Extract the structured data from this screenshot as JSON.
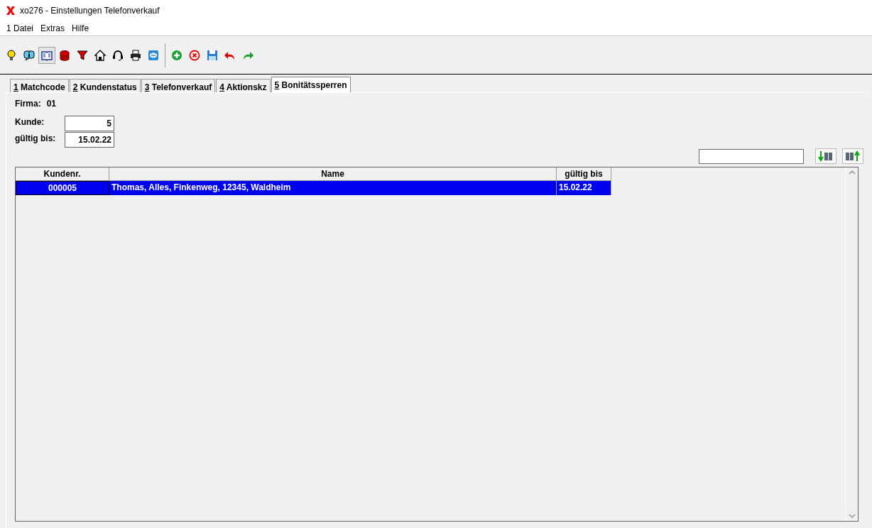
{
  "window": {
    "title": "xo276 - Einstellungen Telefonverkauf"
  },
  "menu": [
    "1 Datei",
    "Extras",
    "Hilfe"
  ],
  "toolbar": [
    {
      "kind": "bulb",
      "pressed": false
    },
    {
      "kind": "info",
      "pressed": false
    },
    {
      "kind": "book",
      "pressed": true
    },
    {
      "kind": "stack",
      "pressed": false
    },
    {
      "kind": "filter",
      "pressed": false
    },
    {
      "kind": "house",
      "pressed": false
    },
    {
      "kind": "headset",
      "pressed": false
    },
    {
      "kind": "printer",
      "pressed": false
    },
    {
      "kind": "remote",
      "pressed": false
    },
    {
      "kind": "sep"
    },
    {
      "kind": "add",
      "pressed": false
    },
    {
      "kind": "delete",
      "pressed": false
    },
    {
      "kind": "save",
      "pressed": false
    },
    {
      "kind": "undo",
      "pressed": false
    },
    {
      "kind": "redo",
      "pressed": false
    }
  ],
  "tabs": [
    {
      "hotkey": "1",
      "label": "Matchcode",
      "selected": false
    },
    {
      "hotkey": "2",
      "label": "Kundenstatus",
      "selected": false
    },
    {
      "hotkey": "3",
      "label": "Telefonverkauf",
      "selected": false
    },
    {
      "hotkey": "4",
      "label": "Aktionskz",
      "selected": false
    },
    {
      "hotkey": "5",
      "label": "Bonitätssperren",
      "selected": true
    }
  ],
  "firma": {
    "label": "Firma:",
    "value": "01"
  },
  "fields": [
    {
      "label": "Kunde:",
      "value": "5"
    },
    {
      "label": "gültig bis:",
      "value": "15.02.22"
    }
  ],
  "table": {
    "columns": [
      "Kundenr.",
      "Name",
      "gültig bis"
    ],
    "rows": [
      {
        "cells": [
          "000005",
          "Thomas, Alles, Finkenweg, 12345, Waldheim",
          "15.02.22"
        ],
        "selected": true
      }
    ]
  }
}
